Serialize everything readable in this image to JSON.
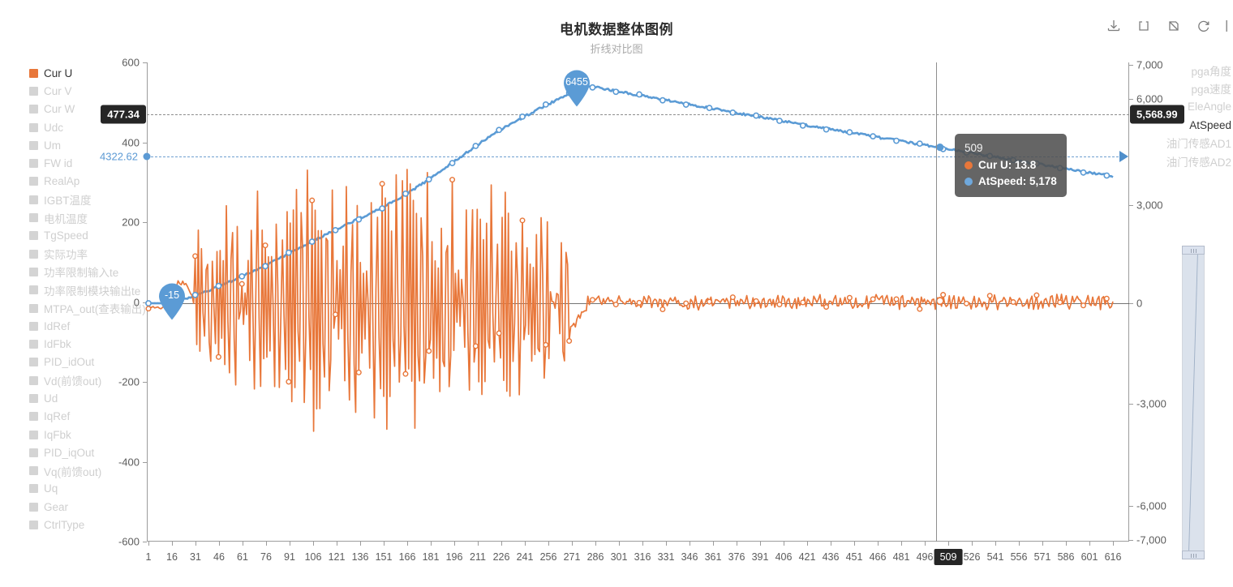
{
  "header": {
    "title": "电机数据整体图例",
    "subtitle": "折线对比图"
  },
  "toolbox": {
    "items": [
      {
        "name": "download-icon",
        "label": "保存为图片"
      },
      {
        "name": "zoom-area-icon",
        "label": "区域缩放"
      },
      {
        "name": "zoom-restore-icon",
        "label": "区域缩放还原"
      },
      {
        "name": "refresh-icon",
        "label": "刷新"
      },
      {
        "name": "divider-icon",
        "label": ""
      }
    ]
  },
  "legend_left": {
    "items": [
      {
        "label": "Cur U",
        "active": true
      },
      {
        "label": "Cur V",
        "active": false
      },
      {
        "label": "Cur W",
        "active": false
      },
      {
        "label": "Udc",
        "active": false
      },
      {
        "label": "Um",
        "active": false
      },
      {
        "label": "FW id",
        "active": false
      },
      {
        "label": "RealAp",
        "active": false
      },
      {
        "label": "IGBT温度",
        "active": false
      },
      {
        "label": "电机温度",
        "active": false
      },
      {
        "label": "TgSpeed",
        "active": false
      },
      {
        "label": "实际功率",
        "active": false
      },
      {
        "label": "功率限制输入te",
        "active": false
      },
      {
        "label": "功率限制模块输出te",
        "active": false
      },
      {
        "label": "MTPA_out(查表输出)",
        "active": false
      },
      {
        "label": "IdRef",
        "active": false
      },
      {
        "label": "IdFbk",
        "active": false
      },
      {
        "label": "PID_idOut",
        "active": false
      },
      {
        "label": "Vd(前馈out)",
        "active": false
      },
      {
        "label": "Ud",
        "active": false
      },
      {
        "label": "IqRef",
        "active": false
      },
      {
        "label": "IqFbk",
        "active": false
      },
      {
        "label": "PID_iqOut",
        "active": false
      },
      {
        "label": "Vq(前馈out)",
        "active": false
      },
      {
        "label": "Uq",
        "active": false
      },
      {
        "label": "Gear",
        "active": false
      },
      {
        "label": "CtrlType",
        "active": false
      }
    ]
  },
  "legend_right": {
    "items": [
      {
        "label": "pga角度",
        "active": false
      },
      {
        "label": "pga速度",
        "active": false
      },
      {
        "label": "EleAngle",
        "active": false
      },
      {
        "label": "AtSpeed",
        "active": true
      },
      {
        "label": "油门传感AD1",
        "active": false
      },
      {
        "label": "油门传感AD2",
        "active": false
      }
    ]
  },
  "axis_pointer": {
    "left_value": "477.34",
    "left_blue_value": "4322.62",
    "right_value": "5,568.99",
    "x_value": "509"
  },
  "tooltip": {
    "title": "509",
    "rows": [
      {
        "name": "Cur U",
        "value": "13.8",
        "color": "#e8773a"
      },
      {
        "name": "AtSpeed",
        "value": "5,178",
        "color": "#6fa8dc"
      }
    ]
  },
  "mark_points": [
    {
      "label": "6455",
      "type": "max"
    },
    {
      "label": "-15",
      "type": "min"
    }
  ],
  "colors": {
    "series_cur_u": "#e8773a",
    "series_atspeed": "#5b9bd5",
    "axis": "#9c9c9c",
    "label": "#5c5c5c",
    "legend_inactive": "#cfcfcf",
    "legend_active": "#333333",
    "tooltip_bg": "#505050",
    "marker_bg": "#262626"
  },
  "chart_data": {
    "type": "line",
    "title": "电机数据整体图例",
    "subtitle": "折线对比图",
    "xlabel": "",
    "ylabel": "",
    "grid": true,
    "legend_position": "left and right",
    "x_tick_labels": [
      "1",
      "16",
      "31",
      "46",
      "61",
      "76",
      "91",
      "106",
      "121",
      "136",
      "151",
      "166",
      "181",
      "196",
      "211",
      "226",
      "241",
      "256",
      "271",
      "286",
      "301",
      "316",
      "331",
      "346",
      "361",
      "376",
      "391",
      "406",
      "421",
      "436",
      "451",
      "466",
      "481",
      "496",
      "509",
      "526",
      "541",
      "556",
      "571",
      "586",
      "601",
      "616"
    ],
    "x_highlight_label": "509",
    "y_left": {
      "name": "Cur U",
      "ticks": [
        600,
        400,
        200,
        0,
        -200,
        -400,
        -600
      ],
      "tick_labels": [
        "600",
        "400",
        "200",
        "0",
        "-200",
        "-400",
        "-600"
      ],
      "ylim": [
        -600,
        600
      ]
    },
    "y_right": {
      "name": "AtSpeed",
      "ticks": [
        7000,
        6000,
        3000,
        0,
        -3000,
        -6000,
        -7000
      ],
      "tick_labels": [
        "7,000",
        "6,000",
        "3,000",
        "0",
        "-3,000",
        "-6,000",
        "-7,000"
      ],
      "ylim": [
        -7000,
        7000
      ]
    },
    "series": [
      {
        "name": "Cur U",
        "axis": "left",
        "color": "#e8773a",
        "markPoint_min": -15,
        "description": "Highly oscillatory current waveform: near zero from x=1-30, large oscillations (±380A) between x=36 and x=272, then low-amplitude ripple (±20A) for the remainder."
      },
      {
        "name": "AtSpeed",
        "axis": "right",
        "color": "#5b9bd5",
        "markPoint_max": 6455,
        "markLine_value": 4322.62,
        "description": "Smooth speed ramp from 0 at x=1 rising to peak 6455 near x=276, then gradually declining to about 3800 at x=620."
      }
    ],
    "annotations": [
      {
        "type": "markPoint",
        "series": "AtSpeed",
        "label": "6455"
      },
      {
        "type": "markPoint",
        "series": "Cur U",
        "label": "-15"
      },
      {
        "type": "axisPointer-y-left",
        "label": "477.34"
      },
      {
        "type": "axisPointer-y-left-secondary",
        "label": "4322.62"
      },
      {
        "type": "axisPointer-y-right",
        "label": "5,568.99"
      },
      {
        "type": "axisPointer-x",
        "label": "509"
      },
      {
        "type": "markLine",
        "series": "AtSpeed",
        "label": "4322.62"
      }
    ]
  }
}
